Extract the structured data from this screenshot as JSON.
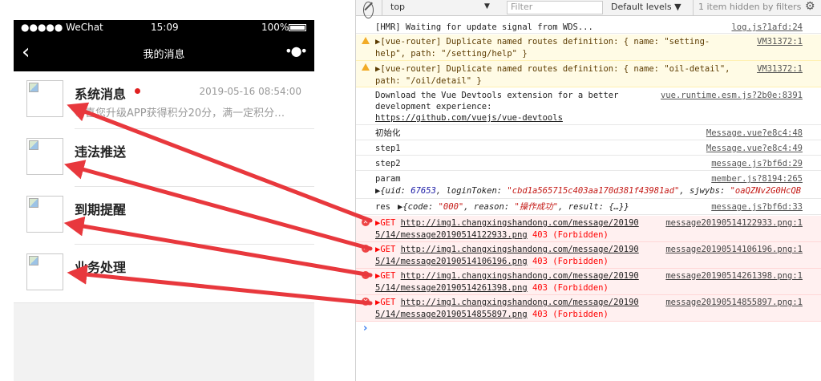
{
  "phone": {
    "statusbar": {
      "carrier": "●●●●● WeChat",
      "time": "15:09",
      "battery": "100%"
    },
    "navbar": {
      "title": "我的消息",
      "back": "‹",
      "more": "•●•"
    },
    "items": [
      {
        "title": "系统消息",
        "time": "2019-05-16 08:54:00",
        "subtitle": "恭喜您升级APP获得积分20分，满一定积分…",
        "has_dot": true
      },
      {
        "title": "违法推送"
      },
      {
        "title": "到期提醒"
      },
      {
        "title": "业务处理"
      }
    ]
  },
  "devtools": {
    "toolbar": {
      "context": "top",
      "filter_placeholder": "Filter",
      "levels": "Default levels ▼",
      "hidden": "1 item hidden by filters"
    },
    "rows": [
      {
        "type": "log",
        "msg": "[HMR] Waiting for update signal from WDS...",
        "src": "log.js?1afd:24"
      },
      {
        "type": "warn",
        "msg1": "▶[vue-router] Duplicate named routes definition: { name: \"setting-",
        "msg2": "help\", path: \"/setting/help\" }",
        "src": "VM31372:1"
      },
      {
        "type": "warn",
        "msg1": "▶[vue-router] Duplicate named routes definition: { name: \"oil-detail\",",
        "msg2": "path: \"/oil/detail\" }",
        "src": "VM31372:1"
      },
      {
        "type": "log",
        "msg1": "Download the Vue Devtools extension for a better",
        "msg2": "development experience:",
        "msg3": "https://github.com/vuejs/vue-devtools",
        "src": "vue.runtime.esm.js?2b0e:8391"
      },
      {
        "type": "log",
        "msg": "初始化",
        "src": "Message.vue?e8c4:48"
      },
      {
        "type": "log",
        "msg": "step1",
        "src": "Message.vue?e8c4:49"
      },
      {
        "type": "log",
        "msg": "step2",
        "src": "message.js?bf6d:29"
      },
      {
        "type": "log",
        "msg": "param",
        "src": "member.js?8194:265",
        "obj": {
          "uid_key": "uid",
          "uid": "67653",
          "token_key": "loginToken",
          "token": "\"cbd1a565715c403aa170d381f43981ad\"",
          "sjwybs_key": "sjwybs",
          "sjwybs": "\"oaQZNv2G0HcQB"
        }
      },
      {
        "type": "log",
        "msg": "res",
        "src": "message.js?bf6d:33",
        "obj": {
          "code_key": "code",
          "code": "\"000\"",
          "reason_key": "reason",
          "reason": "\"操作成功\"",
          "result_key": "result",
          "result": "{…}"
        }
      }
    ],
    "errors": [
      {
        "url1": "http://img1.changxingshandong.com/message/20190",
        "url2": "5/14/message20190514122933.png",
        "src1": "message20190514122933.png:1",
        "status": "403 (Forbidden)"
      },
      {
        "url1": "http://img1.changxingshandong.com/message/20190",
        "url2": "5/14/message20190514106196.png",
        "src1": "message20190514106196.png:1",
        "status": "403 (Forbidden)"
      },
      {
        "url1": "http://img1.changxingshandong.com/message/20190",
        "url2": "5/14/message20190514261398.png",
        "src1": "message20190514261398.png:1",
        "status": "403 (Forbidden)"
      },
      {
        "url1": "http://img1.changxingshandong.com/message/20190",
        "url2": "5/14/message20190514855897.png",
        "src1": "message20190514855897.png:1",
        "status": "403 (Forbidden)"
      }
    ],
    "error_method": "GET",
    "prompt": "›"
  },
  "colors": {
    "arrow": "#e8383d",
    "unread_dot": "#e02020",
    "navbar": "#000000"
  }
}
